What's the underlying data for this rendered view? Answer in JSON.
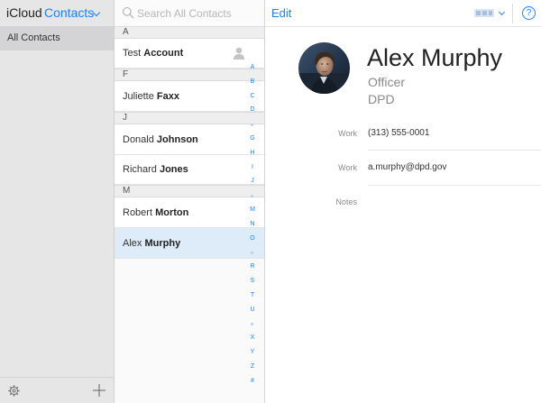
{
  "sidebar": {
    "brand": "iCloud",
    "app_name": "Contacts",
    "groups": [
      {
        "label": "All Contacts"
      }
    ]
  },
  "search": {
    "placeholder": "Search All Contacts"
  },
  "contact_list": {
    "sections": [
      {
        "letter": "A",
        "contacts": [
          {
            "first": "Test",
            "last": "Account",
            "is_me": true
          }
        ]
      },
      {
        "letter": "F",
        "contacts": [
          {
            "first": "Juliette",
            "last": "Faxx"
          }
        ]
      },
      {
        "letter": "J",
        "contacts": [
          {
            "first": "Donald",
            "last": "Johnson"
          },
          {
            "first": "Richard",
            "last": "Jones"
          }
        ]
      },
      {
        "letter": "M",
        "contacts": [
          {
            "first": "Robert",
            "last": "Morton"
          },
          {
            "first": "Alex",
            "last": "Murphy",
            "selected": true
          }
        ]
      }
    ],
    "index": [
      "A",
      "B",
      "C",
      "D",
      "•",
      "G",
      "H",
      "I",
      "J",
      "•",
      "M",
      "N",
      "O",
      "•",
      "R",
      "S",
      "T",
      "U",
      "•",
      "X",
      "Y",
      "Z",
      "#"
    ]
  },
  "detail": {
    "edit_label": "Edit",
    "help_label": "?",
    "name": "Alex Murphy",
    "job_title": "Officer",
    "organization": "DPD",
    "fields": [
      {
        "label": "Work",
        "value": "(313) 555-0001"
      },
      {
        "label": "Work",
        "value": "a.murphy@dpd.gov"
      },
      {
        "label": "Notes",
        "value": ""
      }
    ]
  },
  "colors": {
    "accent": "#1a82fb",
    "selected_row": "#deebf9",
    "sidebar_bg": "#e6e6e7"
  }
}
